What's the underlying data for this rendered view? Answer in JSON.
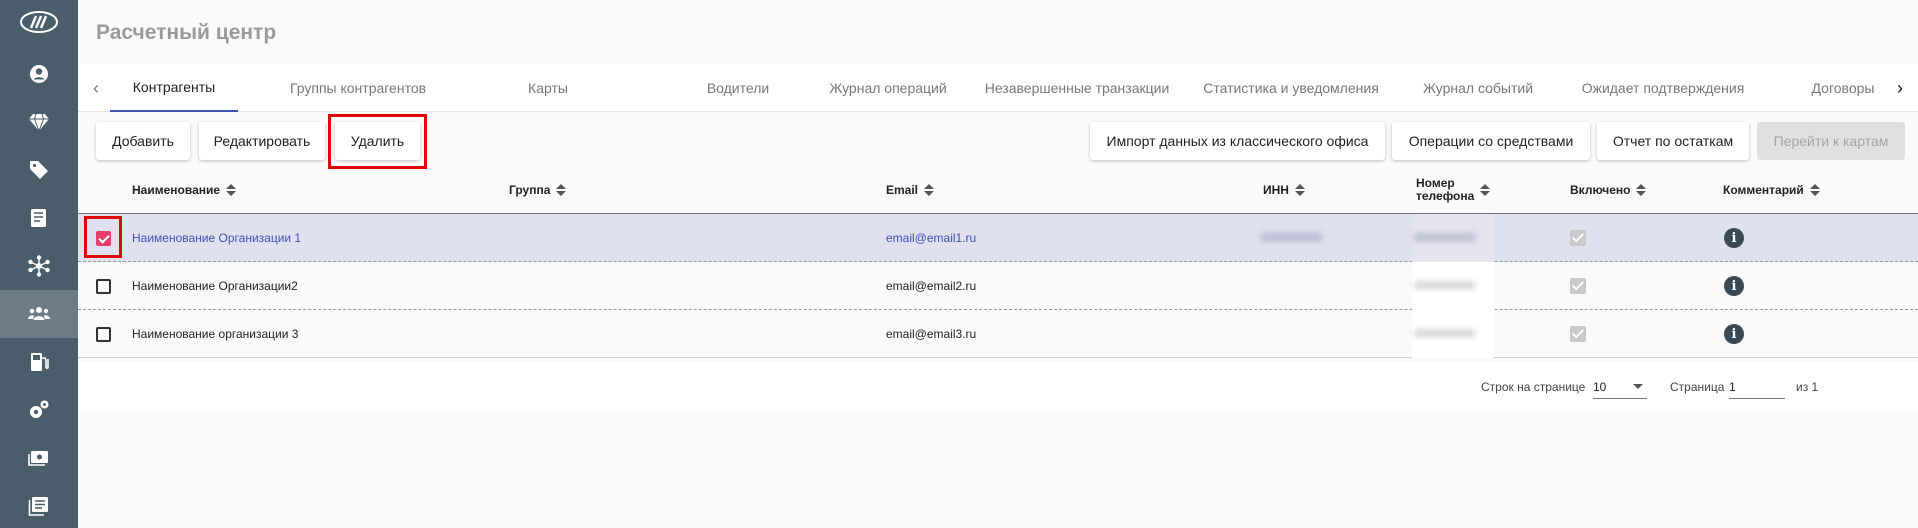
{
  "page": {
    "title": "Расчетный центр"
  },
  "sidebar": {
    "items": [
      {
        "icon": "user-circle-icon"
      },
      {
        "icon": "diamond-icon"
      },
      {
        "icon": "tag-icon"
      },
      {
        "icon": "document-icon"
      },
      {
        "icon": "network-icon"
      },
      {
        "icon": "users-icon",
        "active": true
      },
      {
        "icon": "fuel-pump-icon"
      },
      {
        "icon": "gears-icon"
      },
      {
        "icon": "money-icon"
      },
      {
        "icon": "list-icon"
      }
    ]
  },
  "tabs": [
    {
      "label": "Контрагенты",
      "active": true
    },
    {
      "label": "Группы контрагентов"
    },
    {
      "label": "Карты"
    },
    {
      "label": "Водители"
    },
    {
      "label": "Журнал операций"
    },
    {
      "label": "Незавершенные транзакции"
    },
    {
      "label": "Статистика и уведомления"
    },
    {
      "label": "Журнал событий"
    },
    {
      "label": "Ожидает подтверждения"
    },
    {
      "label": "Договоры"
    }
  ],
  "toolbar": {
    "add": "Добавить",
    "edit": "Редактировать",
    "delete": "Удалить",
    "import": "Импорт данных из классического офиса",
    "funds": "Операции со средствами",
    "balance_report": "Отчет по остаткам",
    "go_to_cards": "Перейти к картам"
  },
  "table": {
    "columns": {
      "name": "Наименование",
      "group": "Группа",
      "email": "Email",
      "inn": "ИНН",
      "phone_line1": "Номер",
      "phone_line2": "телефона",
      "enabled": "Включено",
      "comment": "Комментарий"
    },
    "rows": [
      {
        "name": "Наименование Организации 1",
        "group": "",
        "email": "email@email1.ru",
        "inn": "0000000000",
        "phone": "0000000000",
        "enabled": true,
        "selected": true
      },
      {
        "name": "Наименование Организации2",
        "group": "",
        "email": "email@email2.ru",
        "inn": "",
        "phone": "0000000000",
        "enabled": true,
        "selected": false
      },
      {
        "name": "Наименование организации 3",
        "group": "",
        "email": "email@email3.ru",
        "inn": "",
        "phone": "0000000000",
        "enabled": true,
        "selected": false
      }
    ]
  },
  "pagination": {
    "rows_per_page_label": "Строк на странице",
    "rows_per_page": "10",
    "page_label": "Страница",
    "page": "1",
    "of_label": "из 1"
  },
  "colors": {
    "accent": "#3f51b5",
    "checkbox": "#e53f6e",
    "sidebar": "#4a5d6b",
    "highlight": "#e00000"
  }
}
